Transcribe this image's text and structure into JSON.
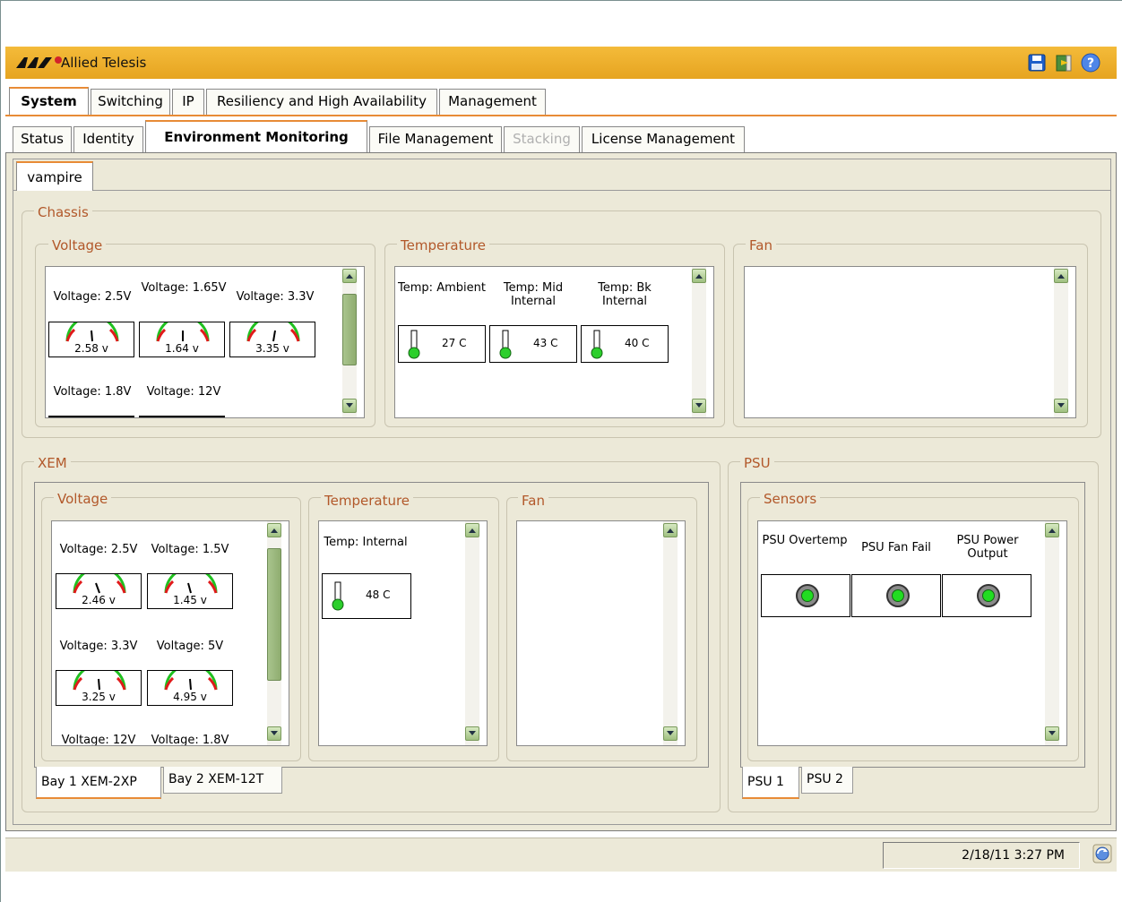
{
  "app": {
    "title": "Allied Telesis",
    "logo_icon": "allied-telesis-logo"
  },
  "main_tabs": [
    {
      "label": "System",
      "active": true
    },
    {
      "label": "Switching"
    },
    {
      "label": "IP"
    },
    {
      "label": "Resiliency and High Availability"
    },
    {
      "label": "Management"
    }
  ],
  "sub_tabs": [
    {
      "label": "Status"
    },
    {
      "label": "Identity"
    },
    {
      "label": "Environment Monitoring",
      "active": true
    },
    {
      "label": "File Management"
    },
    {
      "label": "Stacking",
      "disabled": true
    },
    {
      "label": "License Management"
    }
  ],
  "device_tab": "vampire",
  "chassis": {
    "title": "Chassis",
    "voltage": {
      "title": "Voltage",
      "gauges": [
        {
          "label": "Voltage: 2.5V",
          "value": "2.58 v"
        },
        {
          "label": "Voltage: 1.65V",
          "value": "1.64 v"
        },
        {
          "label": "Voltage: 3.3V",
          "value": "3.35 v"
        }
      ],
      "more_labels": [
        "Voltage: 1.8V",
        "Voltage: 12V"
      ]
    },
    "temperature": {
      "title": "Temperature",
      "sensors": [
        {
          "label": "Temp: Ambient",
          "value": "27 C"
        },
        {
          "label": "Temp: Mid Internal",
          "value": "43 C"
        },
        {
          "label": "Temp: Bk Internal",
          "value": "40 C"
        }
      ]
    },
    "fan": {
      "title": "Fan"
    }
  },
  "xem": {
    "title": "XEM",
    "voltage": {
      "title": "Voltage",
      "gauges": [
        {
          "label": "Voltage: 2.5V",
          "value": "2.46 v"
        },
        {
          "label": "Voltage: 1.5V",
          "value": "1.45 v"
        },
        {
          "label": "Voltage: 3.3V",
          "value": "3.25 v"
        },
        {
          "label": "Voltage: 5V",
          "value": "4.95 v"
        }
      ],
      "more_labels": [
        "Voltage: 12V",
        "Voltage: 1.8V"
      ]
    },
    "temperature": {
      "title": "Temperature",
      "sensors": [
        {
          "label": "Temp: Internal",
          "value": "48 C"
        }
      ]
    },
    "fan": {
      "title": "Fan"
    },
    "bay_tabs": [
      {
        "label": "Bay 1 XEM-2XP",
        "active": true
      },
      {
        "label": "Bay 2 XEM-12T"
      }
    ]
  },
  "psu": {
    "title": "PSU",
    "sensors_title": "Sensors",
    "sensors": [
      {
        "label": "PSU Overtemp",
        "status": "ok"
      },
      {
        "label": "PSU Fan Fail",
        "status": "ok"
      },
      {
        "label": "PSU Power Output",
        "status": "ok"
      }
    ],
    "tabs": [
      {
        "label": "PSU 1",
        "active": true
      },
      {
        "label": "PSU 2"
      }
    ]
  },
  "status_bar": {
    "datetime": "2/18/11 3:27 PM"
  },
  "colors": {
    "accent": "#e88b36",
    "titlebar": "#f0b02c",
    "led_ok": "#22dd22",
    "group_label": "#b2582a"
  }
}
